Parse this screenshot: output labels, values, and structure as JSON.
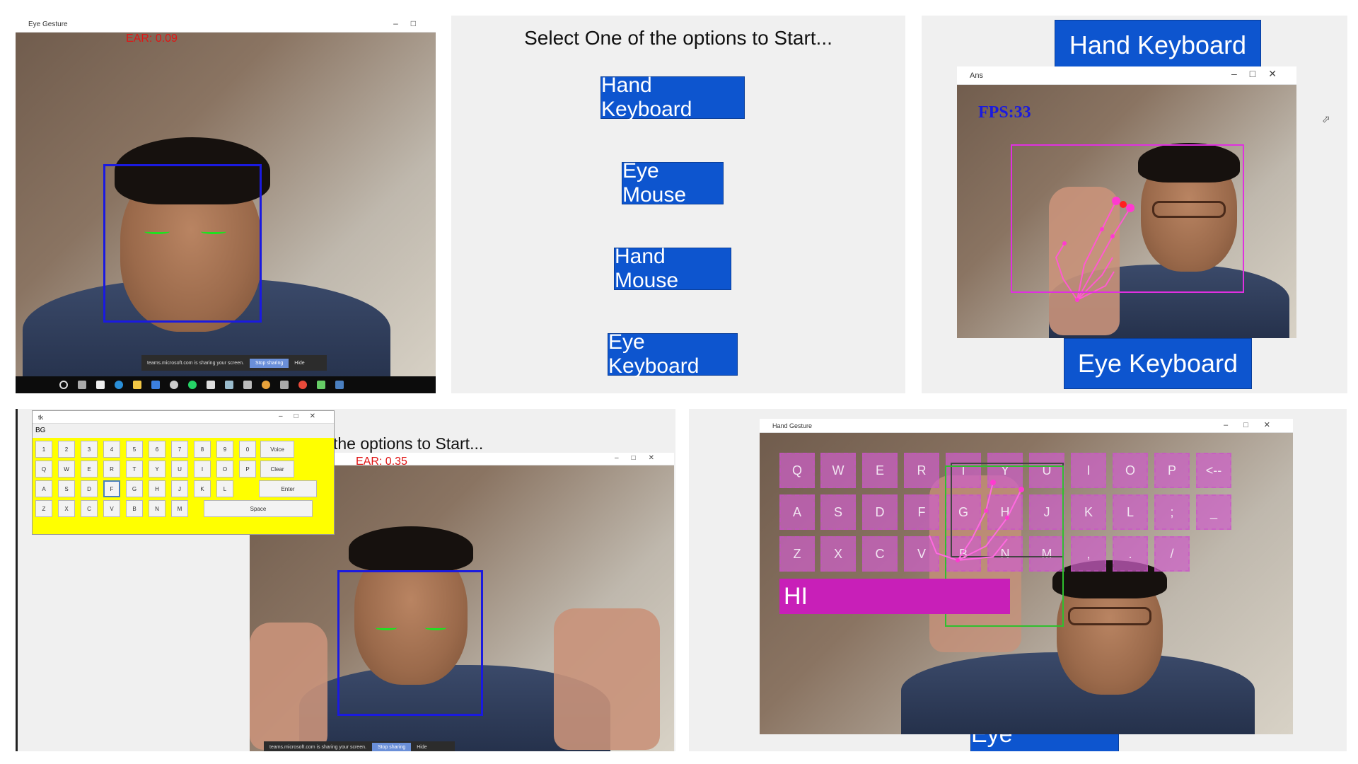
{
  "colors": {
    "button_blue": "#0d55cf",
    "ear_red": "#e01515",
    "bbox_blue": "#1a1ae0",
    "key_magenta": "#cd5fc8",
    "text_box_magenta": "#c81fb8",
    "onscreen_kb_yellow": "#ffff00"
  },
  "panel1": {
    "window_title": "Eye Gesture",
    "ear_text": "EAR: 0.09",
    "share_text": "teams.microsoft.com is sharing your screen.",
    "stop_sharing": "Stop sharing",
    "hide": "Hide"
  },
  "panel2": {
    "prompt": "Select One of the options to Start...",
    "buttons": [
      "Hand Keyboard",
      "Eye Mouse",
      "Hand Mouse",
      "Eye Keyboard"
    ]
  },
  "panel3": {
    "top_button": "Hand Keyboard",
    "window_title": "Ans",
    "fps": "FPS:33",
    "bottom_button": "Eye Keyboard"
  },
  "panel4": {
    "kb_window_title": "tk",
    "kb_input": "BG",
    "row1": [
      "1",
      "2",
      "3",
      "4",
      "5",
      "6",
      "7",
      "8",
      "9",
      "0"
    ],
    "row2": [
      "Q",
      "W",
      "E",
      "R",
      "T",
      "Y",
      "U",
      "I",
      "O",
      "P"
    ],
    "row3": [
      "A",
      "S",
      "D",
      "F",
      "G",
      "H",
      "J",
      "K",
      "L"
    ],
    "row4": [
      "Z",
      "X",
      "C",
      "V",
      "B",
      "N",
      "M"
    ],
    "voice": "Voice",
    "clear": "Clear",
    "enter": "Enter",
    "space": "Space",
    "prompt_partial": "the options to Start...",
    "ear_text": "EAR: 0.35",
    "share_text": "teams.microsoft.com is sharing your screen.",
    "stop_sharing": "Stop sharing",
    "hide": "Hide"
  },
  "panel5": {
    "window_title": "Hand Gesture",
    "row1": [
      "Q",
      "W",
      "E",
      "R",
      "T",
      "Y",
      "U",
      "I",
      "O",
      "P",
      "<--"
    ],
    "row2": [
      "A",
      "S",
      "D",
      "F",
      "G",
      "H",
      "J",
      "K",
      "L",
      ";",
      "_"
    ],
    "row3": [
      "Z",
      "X",
      "C",
      "V",
      "B",
      "N",
      "M",
      ",",
      ".",
      "/"
    ],
    "typed_text": "HI",
    "bottom_button_partial": "Eye Keyboard"
  }
}
